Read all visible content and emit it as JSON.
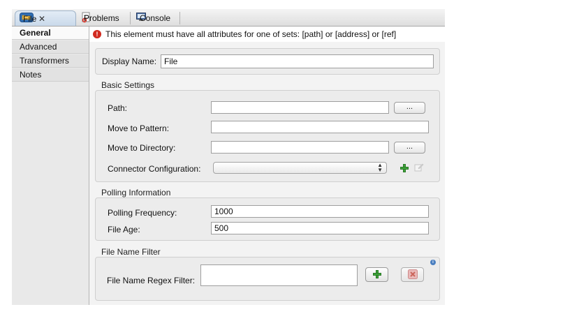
{
  "tabs": [
    {
      "label": "File",
      "icon": "folder-icon",
      "active": true,
      "close": "✕"
    },
    {
      "label": "Problems",
      "icon": "problems-icon",
      "active": false
    },
    {
      "label": "Console",
      "icon": "console-icon",
      "active": false
    }
  ],
  "message": {
    "icon": "error-icon",
    "text": "This element must have all attributes for one of sets: [path] or [address] or [ref]"
  },
  "sidebar": {
    "items": [
      {
        "label": "General",
        "active": true
      },
      {
        "label": "Advanced",
        "active": false
      },
      {
        "label": "Transformers",
        "active": false
      },
      {
        "label": "Notes",
        "active": false
      }
    ]
  },
  "display_name": {
    "label": "Display Name:",
    "value": "File"
  },
  "basic_settings": {
    "title": "Basic Settings",
    "path_label": "Path:",
    "path_value": "",
    "path_browse": "...",
    "move_pattern_label": "Move to Pattern:",
    "move_pattern_value": "",
    "move_directory_label": "Move to Directory:",
    "move_directory_value": "",
    "move_directory_browse": "...",
    "connector_label": "Connector Configuration:",
    "connector_value": ""
  },
  "polling": {
    "title": "Polling Information",
    "frequency_label": "Polling Frequency:",
    "frequency_value": "1000",
    "file_age_label": "File Age:",
    "file_age_value": "500"
  },
  "filter": {
    "title": "File Name Filter",
    "regex_label": "File Name Regex Filter:",
    "regex_value": ""
  },
  "colors": {
    "error": "#d12a1f",
    "add_green": "#3ea33a",
    "remove_red": "#d04040",
    "info_blue": "#4a7fc0"
  }
}
